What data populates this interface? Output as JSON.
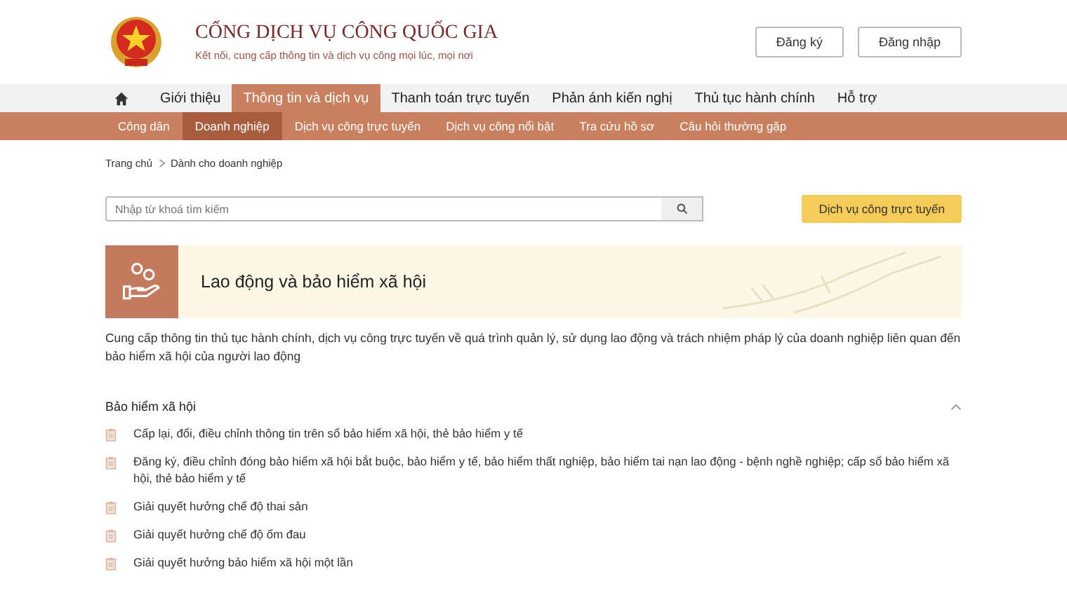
{
  "header": {
    "title": "CỔNG DỊCH VỤ CÔNG QUỐC GIA",
    "tagline": "Kết nối, cung cấp thông tin và dịch vụ công mọi lúc, mọi nơi",
    "buttons": [
      "Đăng ký",
      "Đăng nhập"
    ]
  },
  "main_nav": [
    {
      "label": "Giới thiệu",
      "selected": false
    },
    {
      "label": "Thông tin và dịch vụ",
      "selected": true
    },
    {
      "label": "Thanh toán trực tuyến",
      "selected": false
    },
    {
      "label": "Phản ánh kiến nghị",
      "selected": false
    },
    {
      "label": "Thủ tục hành chính",
      "selected": false
    },
    {
      "label": "Hỗ trợ",
      "selected": false
    }
  ],
  "sub_nav": [
    {
      "label": "Công dân",
      "selected": false
    },
    {
      "label": "Doanh nghiệp",
      "selected": true
    },
    {
      "label": "Dịch vụ công trực tuyến",
      "selected": false
    },
    {
      "label": "Dịch vụ công nổi bật",
      "selected": false
    },
    {
      "label": "Tra cứu hồ sơ",
      "selected": false
    },
    {
      "label": "Câu hỏi thường gặp",
      "selected": false
    }
  ],
  "breadcrumb": [
    "Trang chủ",
    "Dành cho doanh nghiệp"
  ],
  "search": {
    "placeholder": "Nhập từ khoá tìm kiếm"
  },
  "online_service_button": "Dịch vụ công trực tuyến",
  "topic": {
    "title": "Lao động và bảo hiểm xã hội",
    "description": "Cung cấp thông tin thủ tục hành chính, dịch vụ công trực tuyến về quá trình quản lý, sử dụng lao động và trách nhiệm pháp lý của doanh nghiệp liên quan đến bảo hiểm xã hội của người lao động"
  },
  "section": {
    "title": "Bảo hiểm xã hội",
    "expanded": true,
    "items": [
      "Cấp lại, đổi, điều chỉnh thông tin trên sổ bảo hiểm xã hội, thẻ bảo hiểm y tế",
      "Đăng ký, điều chỉnh đóng bảo hiểm xã hội bắt buộc, bảo hiểm y tế, bảo hiểm thất nghiệp, bảo hiểm tai nạn lao động - bệnh nghề nghiệp; cấp sổ bảo hiểm xã hội, thẻ bảo hiểm y tế",
      "Giải quyết hưởng chế độ thai sản",
      "Giải quyết hưởng chế độ ốm đau",
      "Giải quyết hưởng bảo hiểm xã hội một lần"
    ]
  }
}
